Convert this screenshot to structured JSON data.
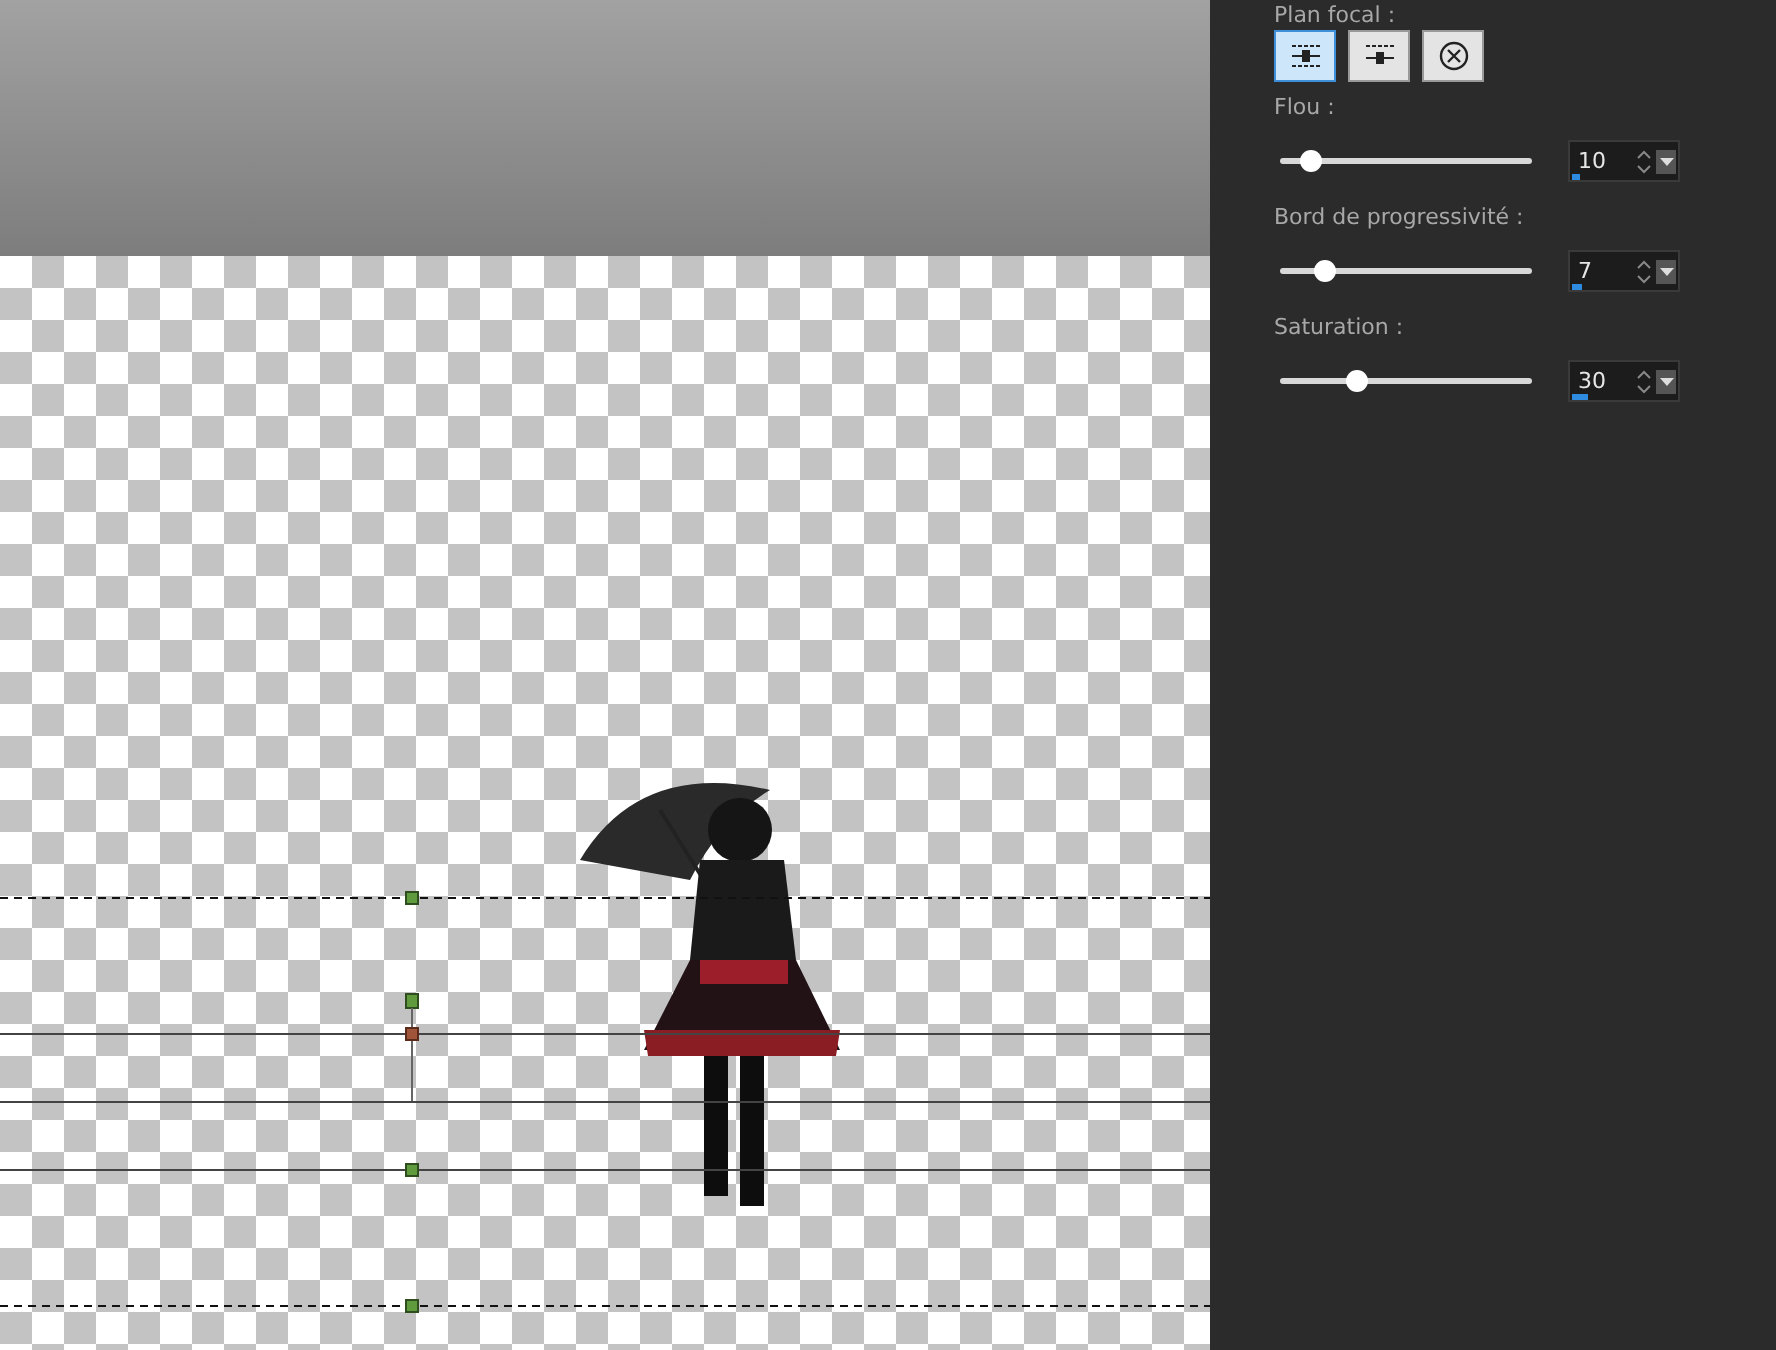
{
  "panel": {
    "focal_label": "Plan focal :",
    "focal_modes": [
      {
        "kind": "symmetric",
        "selected": true
      },
      {
        "kind": "single",
        "selected": false
      },
      {
        "kind": "circle",
        "selected": false
      }
    ],
    "sliders": [
      {
        "label": "Flou :",
        "level": 0.13,
        "value": "10"
      },
      {
        "label": "Bord de progressivité :",
        "level": 0.18,
        "value": "7"
      },
      {
        "label": "Saturation :",
        "level": 0.31,
        "value": "30"
      }
    ]
  },
  "canvas": {
    "guides": [
      {
        "kind": "dashed-handle"
      },
      {
        "kind": "solid-center"
      },
      {
        "kind": "solid"
      },
      {
        "kind": "solid-handle"
      },
      {
        "kind": "dashed-handle"
      }
    ]
  }
}
